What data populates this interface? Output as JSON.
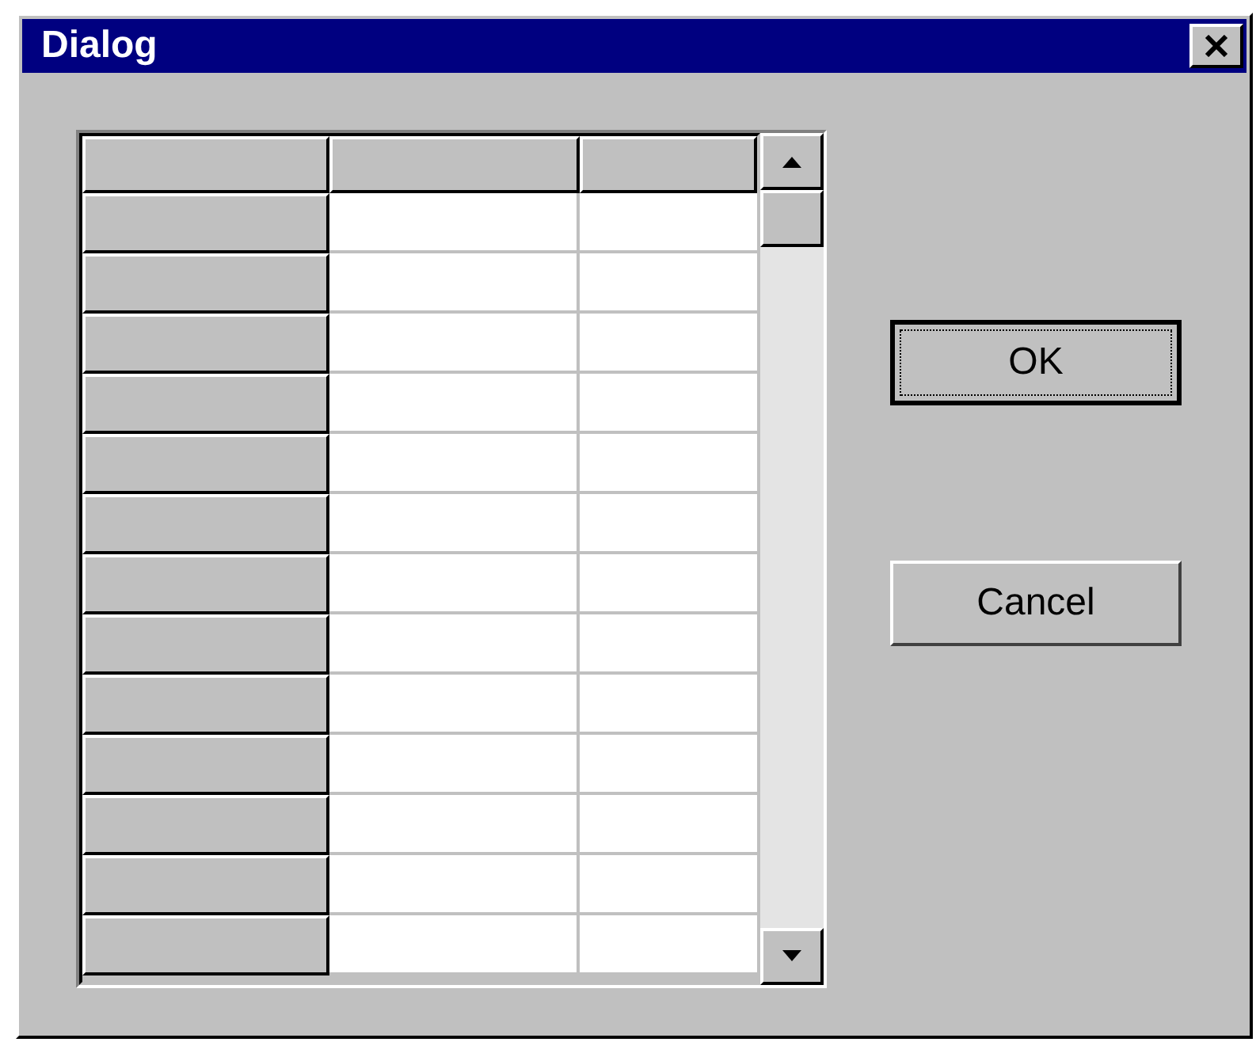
{
  "window": {
    "title": "Dialog"
  },
  "buttons": [
    {
      "label": "OK",
      "default": true
    },
    {
      "label": "Cancel",
      "default": false
    }
  ]
}
